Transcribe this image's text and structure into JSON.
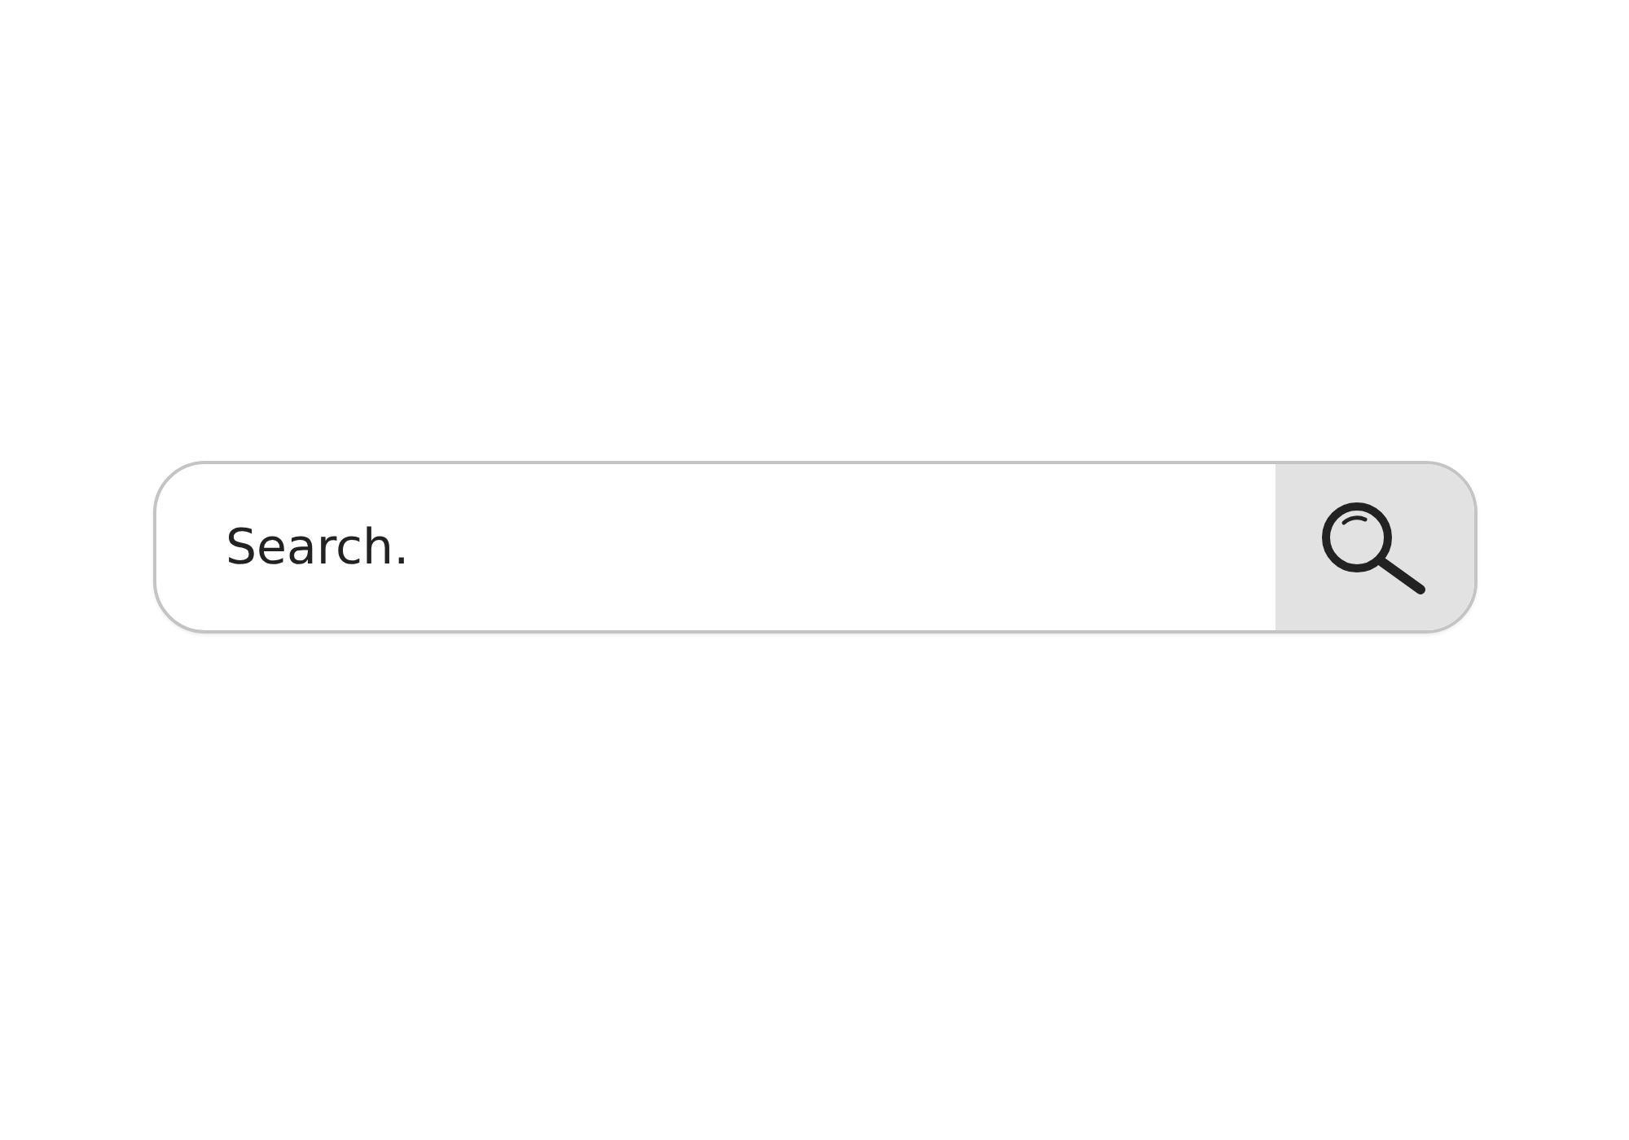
{
  "search": {
    "placeholder": "Search."
  }
}
